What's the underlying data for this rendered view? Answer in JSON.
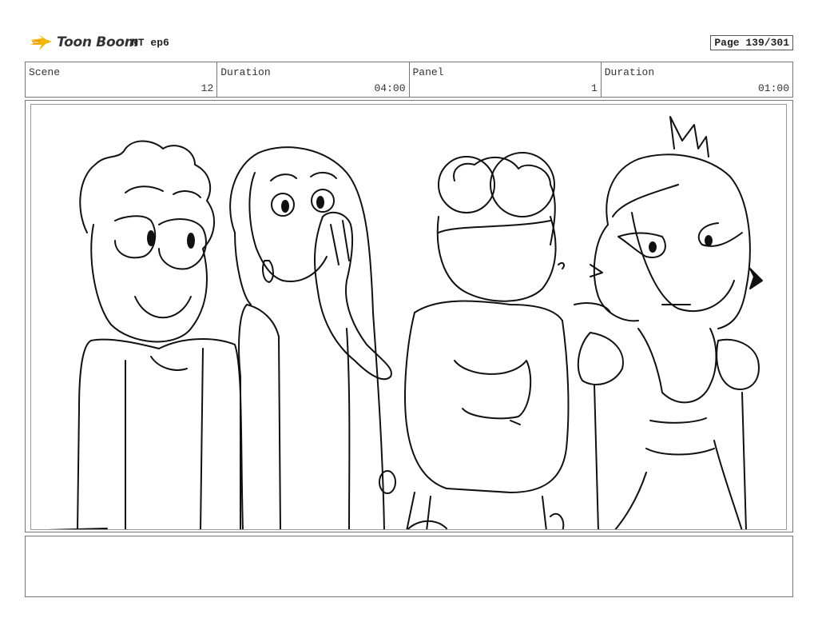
{
  "header": {
    "logo_text": "Toon Boom",
    "project_title": "MT ep6",
    "page_label": "Page 139/301"
  },
  "info": {
    "scene_label": "Scene",
    "scene_value": "12",
    "scene_duration_label": "Duration",
    "scene_duration_value": "04:00",
    "panel_label": "Panel",
    "panel_value": "1",
    "panel_duration_label": "Duration",
    "panel_duration_value": "01:00"
  },
  "panel": {
    "drawing": "sketch-four-characters"
  },
  "notes": {
    "text": ""
  }
}
